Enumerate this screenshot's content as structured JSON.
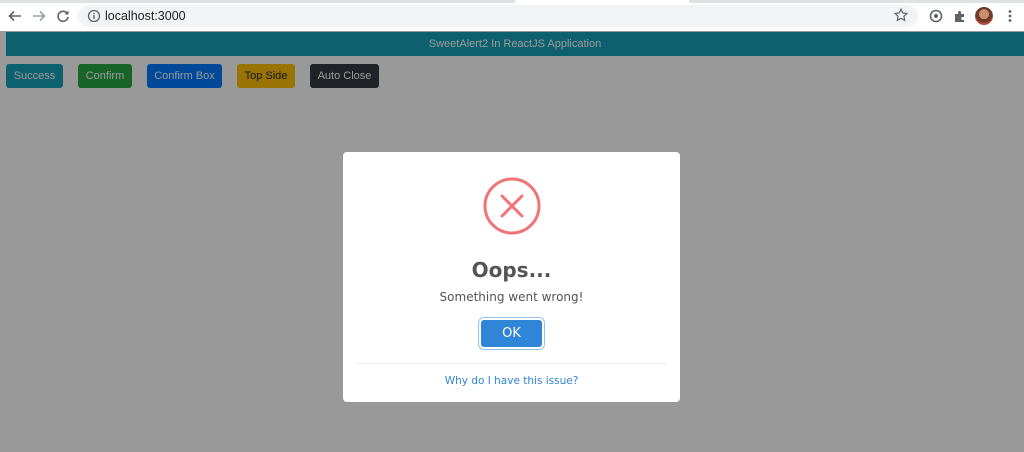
{
  "browser": {
    "url": "localhost:3000"
  },
  "app": {
    "header_title": "SweetAlert2 In ReactJS Application",
    "buttons": [
      {
        "label": "Success",
        "color": "#17a2b8",
        "text_color": "#ffffff"
      },
      {
        "label": "Confirm",
        "color": "#28a745",
        "text_color": "#ffffff"
      },
      {
        "label": "Confirm Box",
        "color": "#007bff",
        "text_color": "#ffffff"
      },
      {
        "label": "Top Side",
        "color": "#ffc107",
        "text_color": "#212529"
      },
      {
        "label": "Auto Close",
        "color": "#343a40",
        "text_color": "#ffffff"
      }
    ]
  },
  "modal": {
    "icon": "error-x-icon",
    "icon_color": "#f27474",
    "title": "Oops...",
    "text": "Something went wrong!",
    "confirm_label": "OK",
    "confirm_color": "#3085d6",
    "footer_link": "Why do I have this issue?"
  }
}
